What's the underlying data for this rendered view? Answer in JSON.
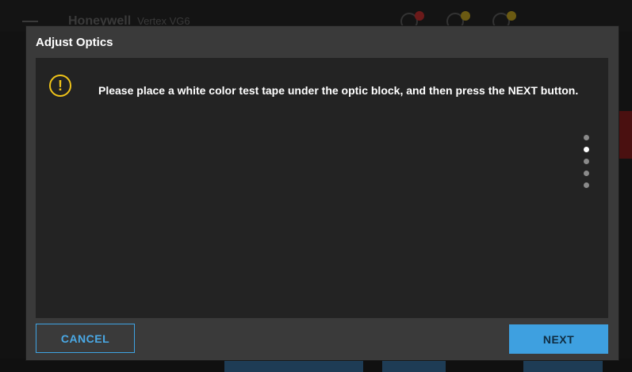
{
  "background": {
    "brand": "Honeywell",
    "product": "Vertex VG6"
  },
  "modal": {
    "title": "Adjust Optics",
    "message": "Please place a white color test tape under the optic block, and then press the NEXT button.",
    "warning_icon": "warning-icon",
    "steps": {
      "total": 5,
      "current": 2
    },
    "cancel_label": "CANCEL",
    "next_label": "NEXT"
  },
  "colors": {
    "accent": "#3ea0e0",
    "warning": "#f0c419"
  }
}
